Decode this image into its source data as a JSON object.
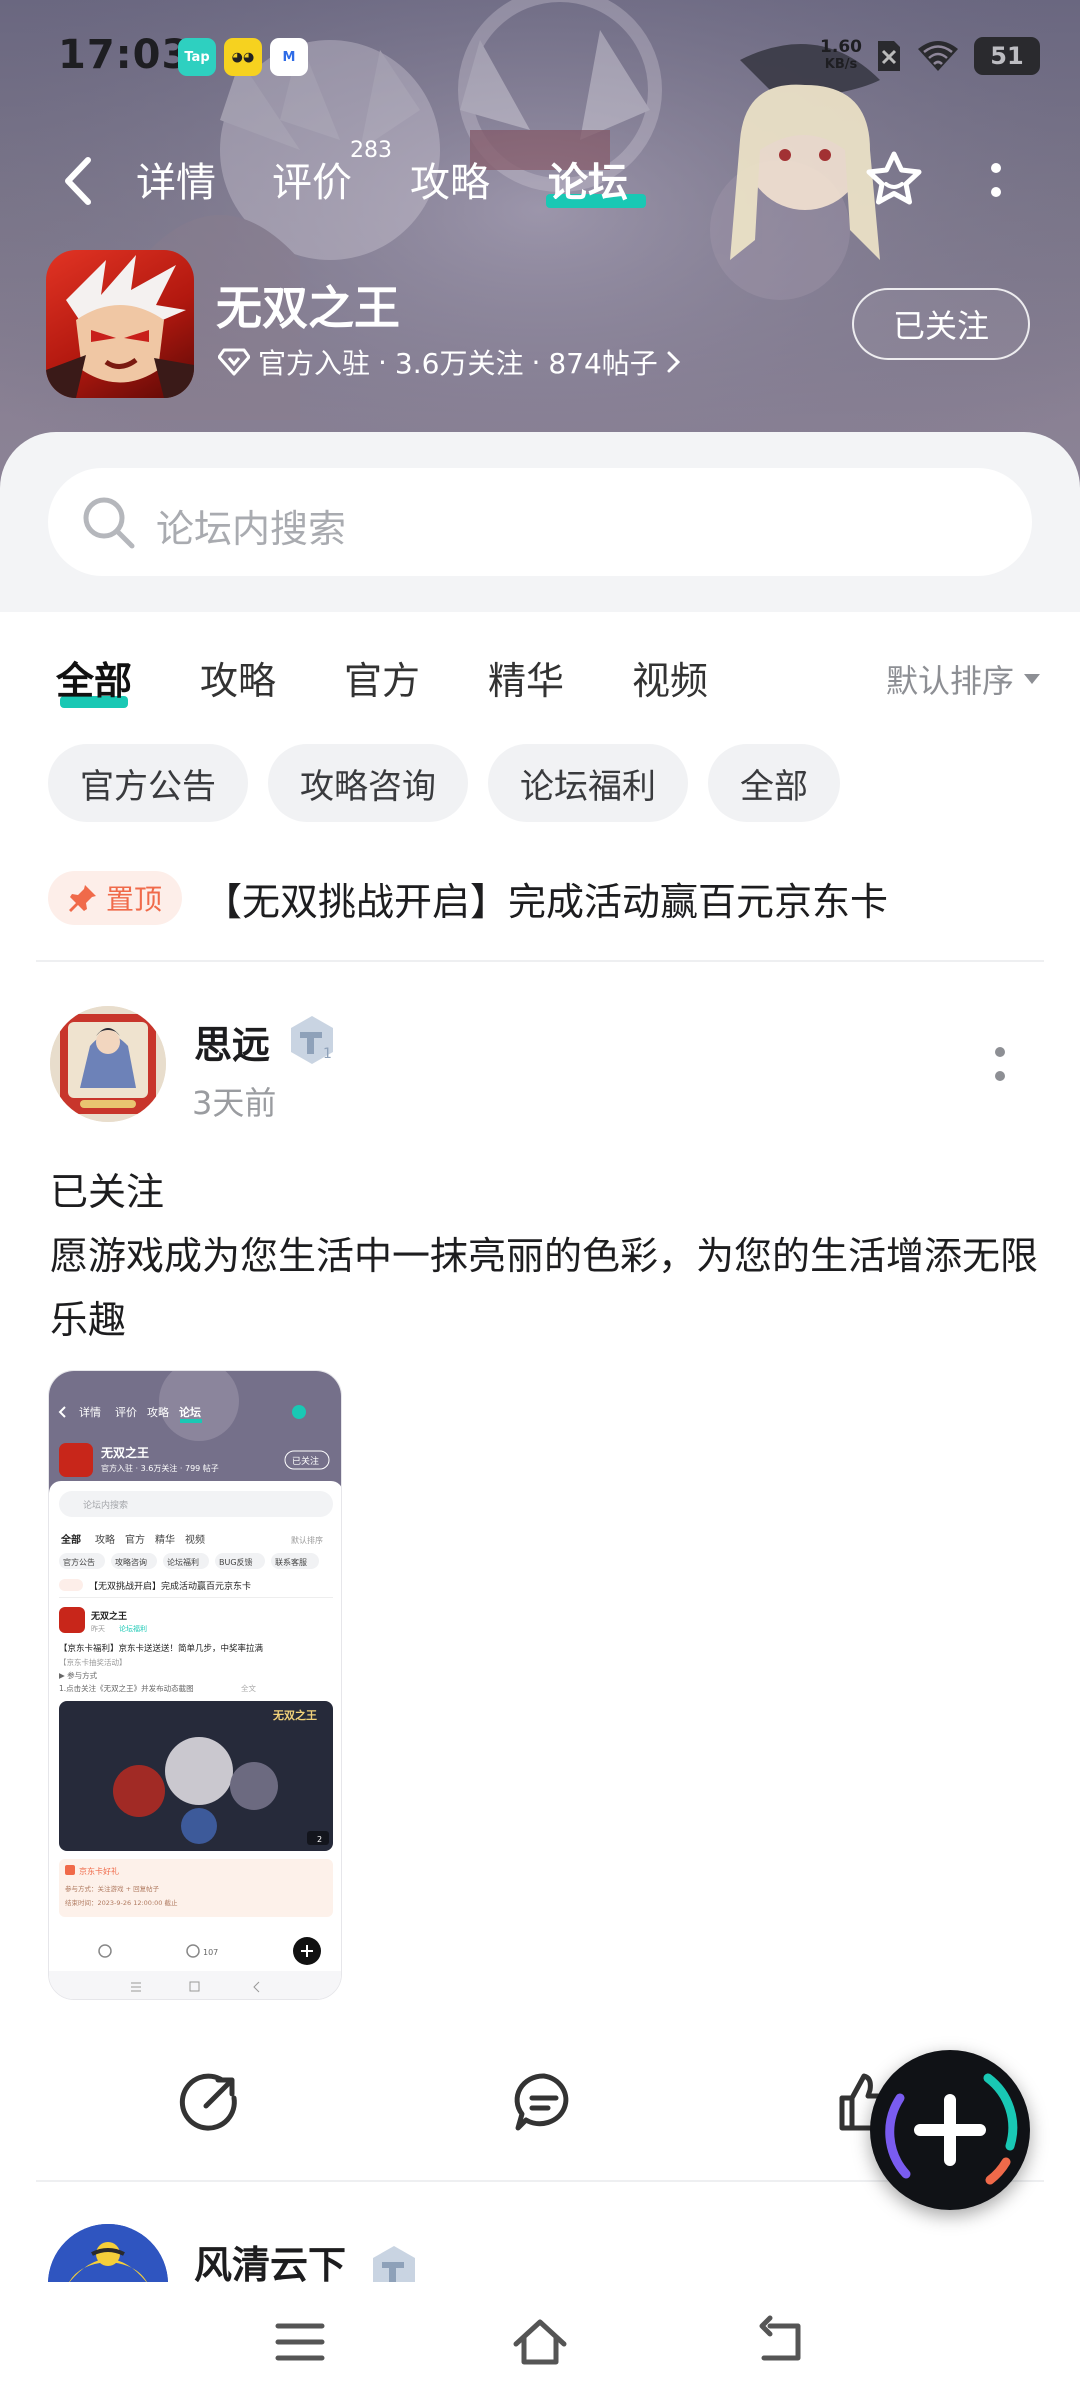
{
  "status_bar": {
    "time": "17:03",
    "network_speed_value": "1.60",
    "network_speed_unit": "KB/s",
    "battery": "51"
  },
  "top_nav": {
    "tabs": [
      {
        "label": "详情",
        "icon": "none"
      },
      {
        "label": "评价",
        "badge": "283"
      },
      {
        "label": "攻略"
      },
      {
        "label": "论坛"
      }
    ],
    "active_tab": "论坛",
    "accent_color": "#19c8b4"
  },
  "game": {
    "name": "无双之王",
    "official_label": "官方入驻",
    "followers": "3.6万关注",
    "posts": "874帖子",
    "separator": "·",
    "follow_button": "已关注"
  },
  "search": {
    "placeholder": "论坛内搜索"
  },
  "forum_tabs": {
    "items": [
      "全部",
      "攻略",
      "官方",
      "精华",
      "视频"
    ],
    "active": "全部",
    "sort_label": "默认排序"
  },
  "chips": [
    "官方公告",
    "攻略咨询",
    "论坛福利",
    "全部"
  ],
  "pinned": {
    "tag": "置顶",
    "title": "【无双挑战开启】完成活动赢百元京东卡"
  },
  "post": {
    "username": "思远",
    "time": "3天前",
    "line1": "已关注",
    "line2": "愿游戏成为您生活中一抹亮丽的色彩，为您的生活增添无限乐趣",
    "thumbnail": {
      "name": "无双之王",
      "tabs": [
        "详情",
        "评价",
        "攻略",
        "论坛"
      ],
      "follow": "已关注",
      "meta": "官方入驻 · 3.6万关注 · 799 帖子",
      "search": "论坛内搜索",
      "forum_tabs": [
        "全部",
        "攻略",
        "官方",
        "精华",
        "视频"
      ],
      "sort": "默认排序",
      "chips": [
        "官方公告",
        "攻略咨询",
        "论坛福利",
        "BUG反馈",
        "联系客服"
      ],
      "pinned": "【无双挑战开启】完成活动赢百元京东卡",
      "post_user": "无双之王",
      "post_time": "昨天",
      "post_tag": "论坛福利",
      "post_title": "【京东卡福利】京东卡送送送！简单几步，中奖率拉满",
      "post_sub1": "【京东卡抽奖活动】",
      "post_sub2": "▶ 参与方式",
      "post_sub3": "1.点击关注《无双之王》并发布动态截图",
      "post_sub3_more": "全文",
      "banner_logo": "无双之王",
      "banner_count": "2",
      "card_title": "京东卡好礼",
      "card_line1": "参与方式：关注游戏 + 回复帖子",
      "card_line2": "结束时间：2023-9-26 12:00:00 截止",
      "comment_count": "107"
    }
  },
  "next_post": {
    "username": "风清云下"
  }
}
